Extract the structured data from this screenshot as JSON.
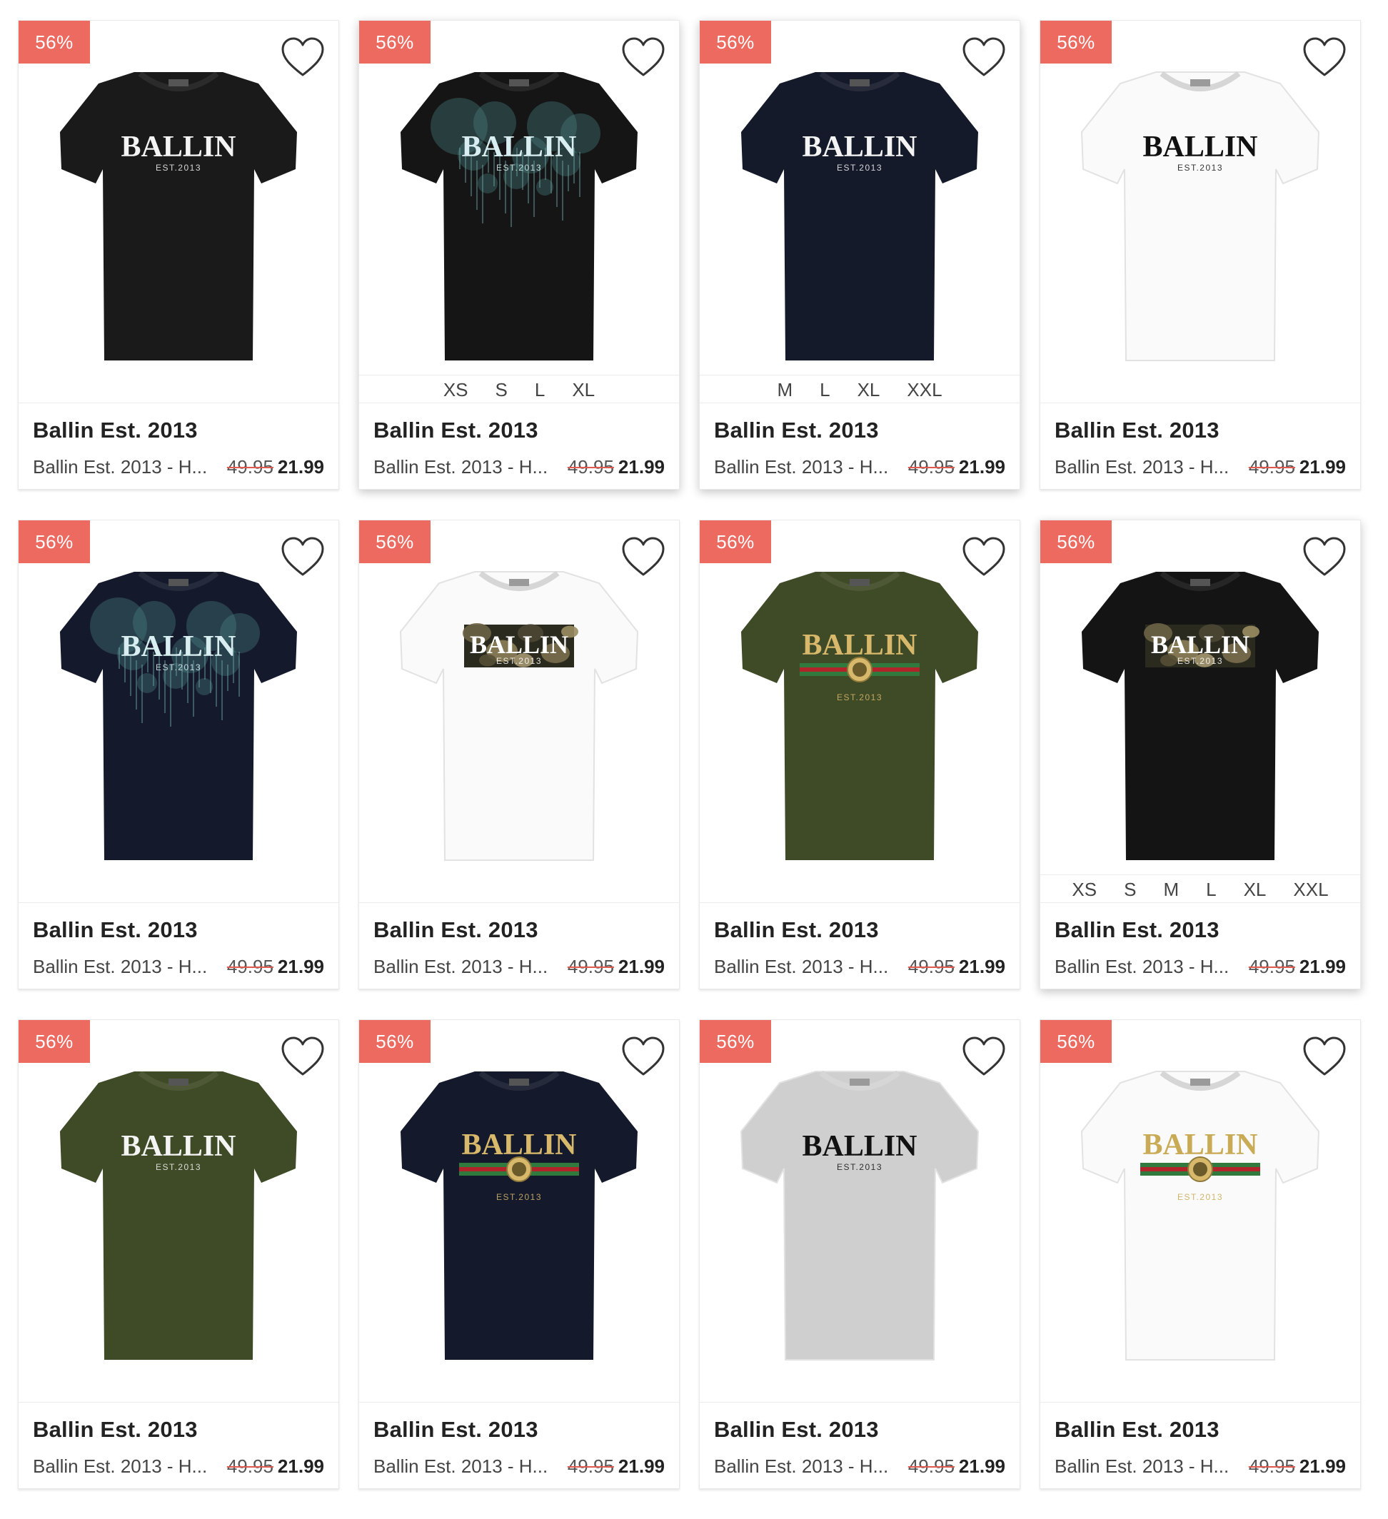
{
  "theme": {
    "badge_color": "#ec6a60",
    "strike_color": "#e05a50"
  },
  "products": [
    {
      "badge": "56%",
      "brand": "Ballin Est. 2013",
      "name": "Ballin Est. 2013 - H...",
      "old_price": "49.95",
      "price": "21.99",
      "sizes": [],
      "shirt": {
        "color": "#1a1a1a",
        "print": "plain",
        "logo_text": "BALLIN",
        "sub_text": "EST.2013",
        "text_color": "#f4f4f4"
      }
    },
    {
      "badge": "56%",
      "brand": "Ballin Est. 2013",
      "name": "Ballin Est. 2013 - H...",
      "old_price": "49.95",
      "price": "21.99",
      "sizes": [
        "XS",
        "S",
        "L",
        "XL"
      ],
      "shirt": {
        "color": "#151515",
        "print": "splash",
        "logo_text": "BALLIN",
        "sub_text": "EST.2013",
        "text_color": "#d8eef0"
      }
    },
    {
      "badge": "56%",
      "brand": "Ballin Est. 2013",
      "name": "Ballin Est. 2013 - H...",
      "old_price": "49.95",
      "price": "21.99",
      "sizes": [
        "M",
        "L",
        "XL",
        "XXL"
      ],
      "shirt": {
        "color": "#151a2a",
        "print": "plain",
        "logo_text": "BALLIN",
        "sub_text": "EST.2013",
        "text_color": "#f4f4f4"
      }
    },
    {
      "badge": "56%",
      "brand": "Ballin Est. 2013",
      "name": "Ballin Est. 2013 - H...",
      "old_price": "49.95",
      "price": "21.99",
      "sizes": [],
      "shirt": {
        "color": "#fafafa",
        "print": "plain",
        "logo_text": "BALLIN",
        "sub_text": "EST.2013",
        "text_color": "#111111"
      }
    },
    {
      "badge": "56%",
      "brand": "Ballin Est. 2013",
      "name": "Ballin Est. 2013 - H...",
      "old_price": "49.95",
      "price": "21.99",
      "sizes": [],
      "shirt": {
        "color": "#141a2b",
        "print": "splash",
        "logo_text": "BALLIN",
        "sub_text": "EST.2013",
        "text_color": "#d8eef0"
      }
    },
    {
      "badge": "56%",
      "brand": "Ballin Est. 2013",
      "name": "Ballin Est. 2013 - H...",
      "old_price": "49.95",
      "price": "21.99",
      "sizes": [],
      "shirt": {
        "color": "#fafafa",
        "print": "camo",
        "logo_text": "BALLIN",
        "sub_text": "EST.2013",
        "text_color": "#ffffff"
      }
    },
    {
      "badge": "56%",
      "brand": "Ballin Est. 2013",
      "name": "Ballin Est. 2013 - H...",
      "old_price": "49.95",
      "price": "21.99",
      "sizes": [],
      "shirt": {
        "color": "#3f4a26",
        "print": "stripe",
        "logo_text": "BALLIN",
        "sub_text": "EST.2013",
        "text_color": "#d8b96b"
      }
    },
    {
      "badge": "56%",
      "brand": "Ballin Est. 2013",
      "name": "Ballin Est. 2013 - H...",
      "old_price": "49.95",
      "price": "21.99",
      "sizes": [
        "XS",
        "S",
        "M",
        "L",
        "XL",
        "XXL"
      ],
      "shirt": {
        "color": "#141414",
        "print": "camo",
        "logo_text": "BALLIN",
        "sub_text": "EST.2013",
        "text_color": "#ffffff"
      }
    },
    {
      "badge": "56%",
      "brand": "Ballin Est. 2013",
      "name": "Ballin Est. 2013 - H...",
      "old_price": "49.95",
      "price": "21.99",
      "sizes": [],
      "shirt": {
        "color": "#3f4a26",
        "print": "plain",
        "logo_text": "BALLIN",
        "sub_text": "EST.2013",
        "text_color": "#f4f4f4"
      }
    },
    {
      "badge": "56%",
      "brand": "Ballin Est. 2013",
      "name": "Ballin Est. 2013 - H...",
      "old_price": "49.95",
      "price": "21.99",
      "sizes": [],
      "shirt": {
        "color": "#141a2b",
        "print": "stripe",
        "logo_text": "BALLIN",
        "sub_text": "EST.2013",
        "text_color": "#d8b96b"
      }
    },
    {
      "badge": "56%",
      "brand": "Ballin Est. 2013",
      "name": "Ballin Est. 2013 - H...",
      "old_price": "49.95",
      "price": "21.99",
      "sizes": [],
      "shirt": {
        "color": "#cfcfcf",
        "print": "plain",
        "logo_text": "BALLIN",
        "sub_text": "EST.2013",
        "text_color": "#111111"
      }
    },
    {
      "badge": "56%",
      "brand": "Ballin Est. 2013",
      "name": "Ballin Est. 2013 - H...",
      "old_price": "49.95",
      "price": "21.99",
      "sizes": [],
      "shirt": {
        "color": "#fafafa",
        "print": "stripe",
        "logo_text": "BALLIN",
        "sub_text": "EST.2013",
        "text_color": "#c9aa55"
      }
    }
  ]
}
